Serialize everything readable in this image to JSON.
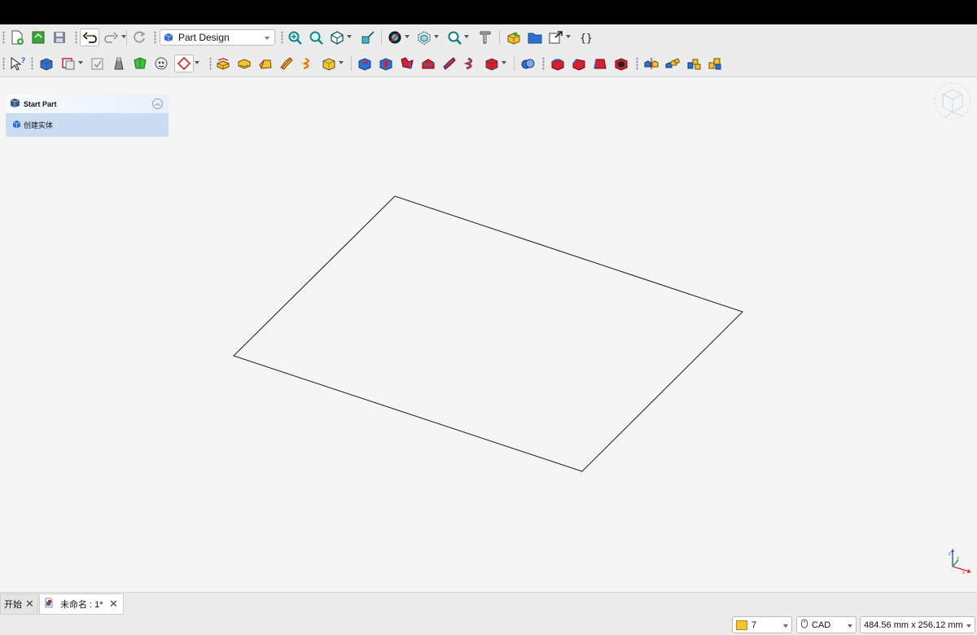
{
  "toolbar": {
    "workbench_selector": {
      "value": "Part Design"
    }
  },
  "task_panel": {
    "title": "Start Part",
    "actions": [
      {
        "label": "创建实体"
      }
    ]
  },
  "tabs": [
    {
      "label": "开始",
      "active": false
    },
    {
      "label": "未命名 : 1*",
      "active": true
    }
  ],
  "statusbar": {
    "style_value": "7",
    "navigation_style": "CAD",
    "dimensions": "484.56 mm x 256.12 mm"
  },
  "colors": {
    "accent_blue": "#2f6fd1",
    "pad_yellow": "#f2c530",
    "pocket_red": "#d2212f",
    "selection_panel": "#cbdcf3"
  },
  "icons": [
    "new-document-icon",
    "open-document-icon",
    "save-icon",
    "undo-icon",
    "redo-icon",
    "refresh-icon",
    "fit-all-icon",
    "fit-selection-icon",
    "view-isometric-icon",
    "view-menu-icon",
    "draw-style-icon",
    "bounding-box-icon",
    "zoom-icon",
    "measure-icon",
    "part-icon",
    "group-icon",
    "link-icon",
    "macro-icon",
    "whats-this-icon",
    "body-icon",
    "sketch-icon",
    "validate-sketch-icon",
    "shape-binder-icon",
    "subshape-binder-icon",
    "clone-icon",
    "datum-plane-icon",
    "pad-icon",
    "revolution-icon",
    "additive-loft-icon",
    "additive-pipe-icon",
    "additive-helix-icon",
    "additive-primitive-icon",
    "pocket-icon",
    "hole-icon",
    "groove-icon",
    "subtractive-loft-icon",
    "subtractive-pipe-icon",
    "subtractive-helix-icon",
    "subtractive-primitive-icon",
    "boolean-icon",
    "fillet-icon",
    "chamfer-icon",
    "draft-icon",
    "thickness-icon",
    "mirrored-icon",
    "linear-pattern-icon",
    "polar-pattern-icon",
    "multi-transform-icon"
  ]
}
